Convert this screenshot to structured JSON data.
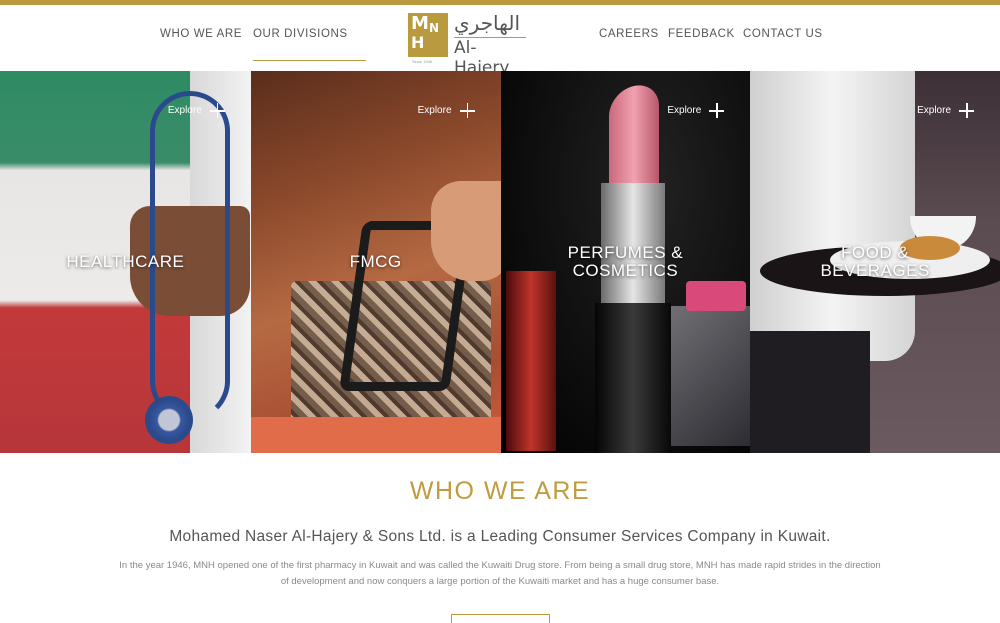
{
  "colors": {
    "accent": "#b99a3e",
    "heading_gold": "#c09b3f",
    "nav_text": "#555555"
  },
  "nav": {
    "left": [
      "WHO WE ARE",
      "OUR DIVISIONS"
    ],
    "right": [
      "CAREERS",
      "FEEDBACK",
      "CONTACT US"
    ],
    "active": "OUR DIVISIONS"
  },
  "logo": {
    "monogram": [
      "M",
      "N",
      "H"
    ],
    "arabic": "الهاجري",
    "english": "Al-Hajery",
    "since": "Since 1946"
  },
  "divisions": [
    {
      "explore": "Explore",
      "icon": "plus-icon",
      "title_lines": [
        "HEALTHCARE"
      ]
    },
    {
      "explore": "Explore",
      "icon": "plus-icon",
      "title_lines": [
        "FMCG"
      ]
    },
    {
      "explore": "Explore",
      "icon": "plus-icon",
      "title_lines": [
        "PERFUMES &",
        "COSMETICS"
      ]
    },
    {
      "explore": "Explore",
      "icon": "plus-icon",
      "title_lines": [
        "FOOD &",
        "BEVERAGES"
      ]
    }
  ],
  "about": {
    "heading": "WHO WE ARE",
    "lead": "Mohamed Naser Al-Hajery & Sons Ltd. is a Leading Consumer Services Company in Kuwait.",
    "body": "In the year 1946, MNH opened one of the first pharmacy in Kuwait and was called the Kuwaiti Drug store. From being a small drug store, MNH has made rapid strides in the direction of development and now conquers a large portion of the Kuwaiti market and has a huge consumer base."
  }
}
